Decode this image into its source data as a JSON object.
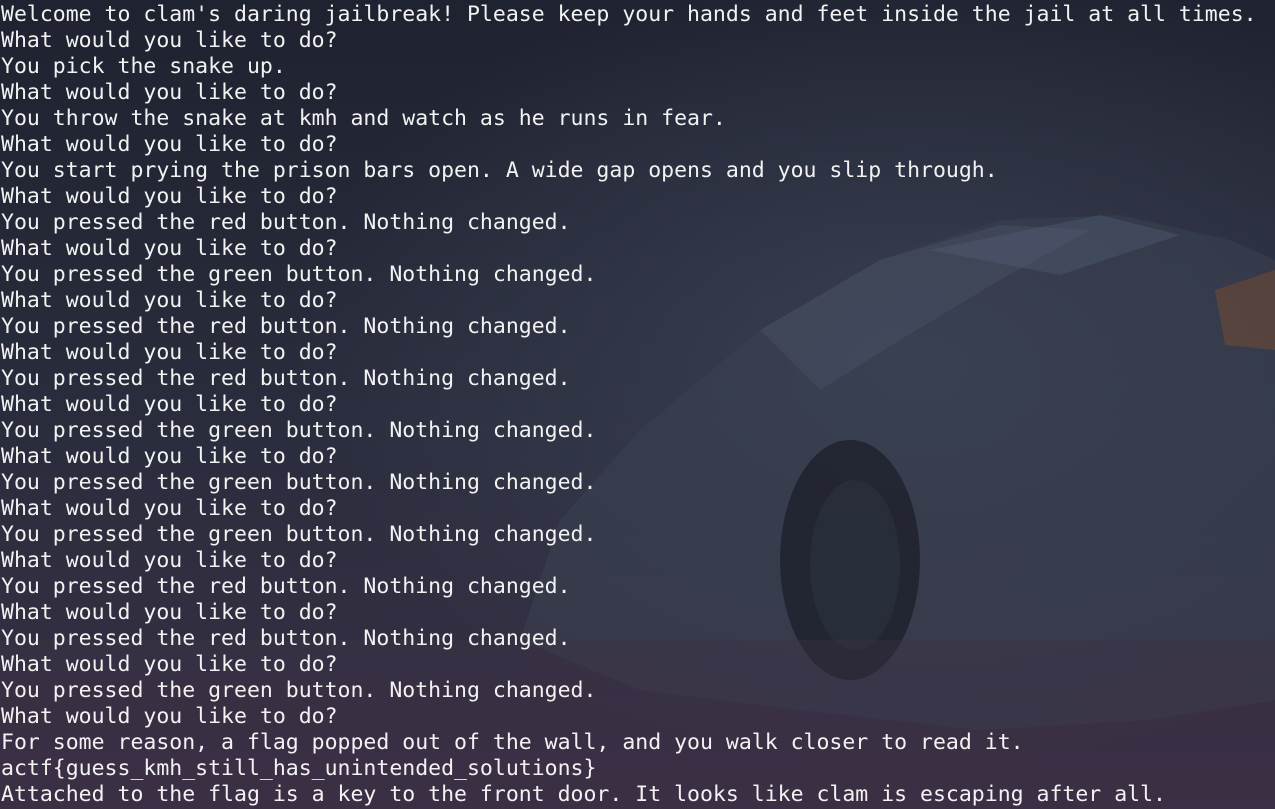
{
  "terminal": {
    "lines": [
      "Welcome to clam's daring jailbreak! Please keep your hands and feet inside the jail at all times.",
      "What would you like to do?",
      "You pick the snake up.",
      "What would you like to do?",
      "You throw the snake at kmh and watch as he runs in fear.",
      "What would you like to do?",
      "You start prying the prison bars open. A wide gap opens and you slip through.",
      "What would you like to do?",
      "You pressed the red button. Nothing changed.",
      "What would you like to do?",
      "You pressed the green button. Nothing changed.",
      "What would you like to do?",
      "You pressed the red button. Nothing changed.",
      "What would you like to do?",
      "You pressed the red button. Nothing changed.",
      "What would you like to do?",
      "You pressed the green button. Nothing changed.",
      "What would you like to do?",
      "You pressed the green button. Nothing changed.",
      "What would you like to do?",
      "You pressed the green button. Nothing changed.",
      "What would you like to do?",
      "You pressed the red button. Nothing changed.",
      "What would you like to do?",
      "You pressed the red button. Nothing changed.",
      "What would you like to do?",
      "You pressed the green button. Nothing changed.",
      "What would you like to do?",
      "For some reason, a flag popped out of the wall, and you walk closer to read it.",
      "actf{guess_kmh_still_has_unintended_solutions}",
      "Attached to the flag is a key to the front door. It looks like clam is escaping after all."
    ]
  },
  "colors": {
    "text": "#f2f2f2",
    "background": "#232633",
    "accent_orange": "#6e4a36"
  }
}
